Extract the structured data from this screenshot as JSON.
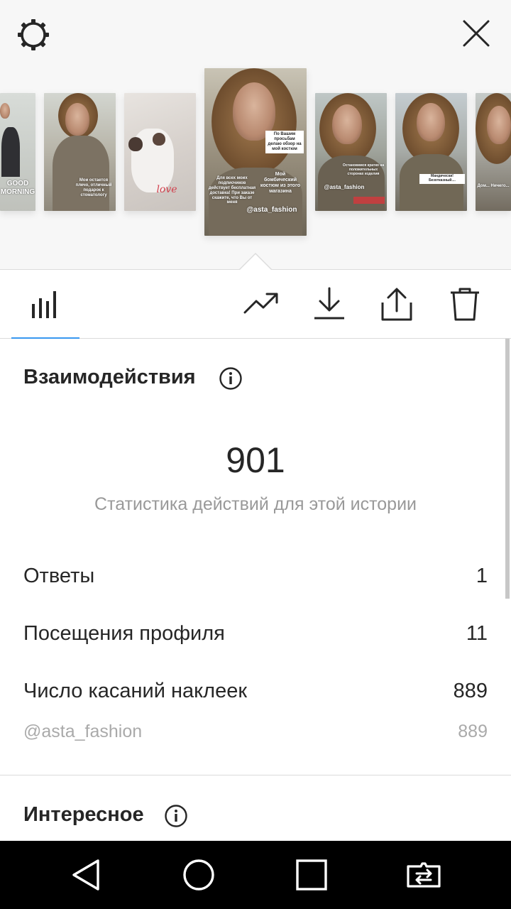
{
  "top": {
    "settings_icon": "gear-icon",
    "close_icon": "close-icon",
    "stories": [
      {
        "id": "story-1",
        "caption": "GOOD MORNING"
      },
      {
        "id": "story-2",
        "caption": "Мои остается плечо, отличный подарок к стоматологу"
      },
      {
        "id": "story-3",
        "caption": "love"
      },
      {
        "id": "story-4",
        "caption_top": "По Вашим просьбам делаю обзор на мой костюм",
        "caption_left": "Для всех моих подписчиков действует бесплатная доставка! При заказе скажите, что Вы от меня",
        "caption_right": "Мой бомбический костюм из этого магазина",
        "mention": "@asta_fashion"
      },
      {
        "id": "story-5",
        "caption_top": "Остановимся кратко на положительных сторонах изделия",
        "mention": "@asta_fashion"
      },
      {
        "id": "story-6",
        "caption": "Мандически! Безотказный...."
      },
      {
        "id": "story-7",
        "caption": "Дом... Ничего..."
      }
    ]
  },
  "toolbar": {
    "insights_icon": "bar-chart-icon",
    "promote_icon": "trending-up-icon",
    "download_icon": "download-icon",
    "share_icon": "share-icon",
    "delete_icon": "trash-icon"
  },
  "interactions": {
    "title": "Взаимодействия",
    "total": "901",
    "subtitle": "Статистика действий для этой истории",
    "rows": [
      {
        "label": "Ответы",
        "value": "1"
      },
      {
        "label": "Посещения профиля",
        "value": "11"
      },
      {
        "label": "Число касаний наклеек",
        "value": "889"
      }
    ],
    "sticker_detail": {
      "label": "@asta_fashion",
      "value": "889"
    }
  },
  "discovery": {
    "title": "Интересное"
  },
  "navbar": {
    "back_icon": "back-triangle-icon",
    "home_icon": "home-circle-icon",
    "recents_icon": "recents-square-icon",
    "switch_icon": "switch-app-icon"
  },
  "colors": {
    "accent": "#3897f0",
    "text": "#262626",
    "secondary": "#999999"
  }
}
